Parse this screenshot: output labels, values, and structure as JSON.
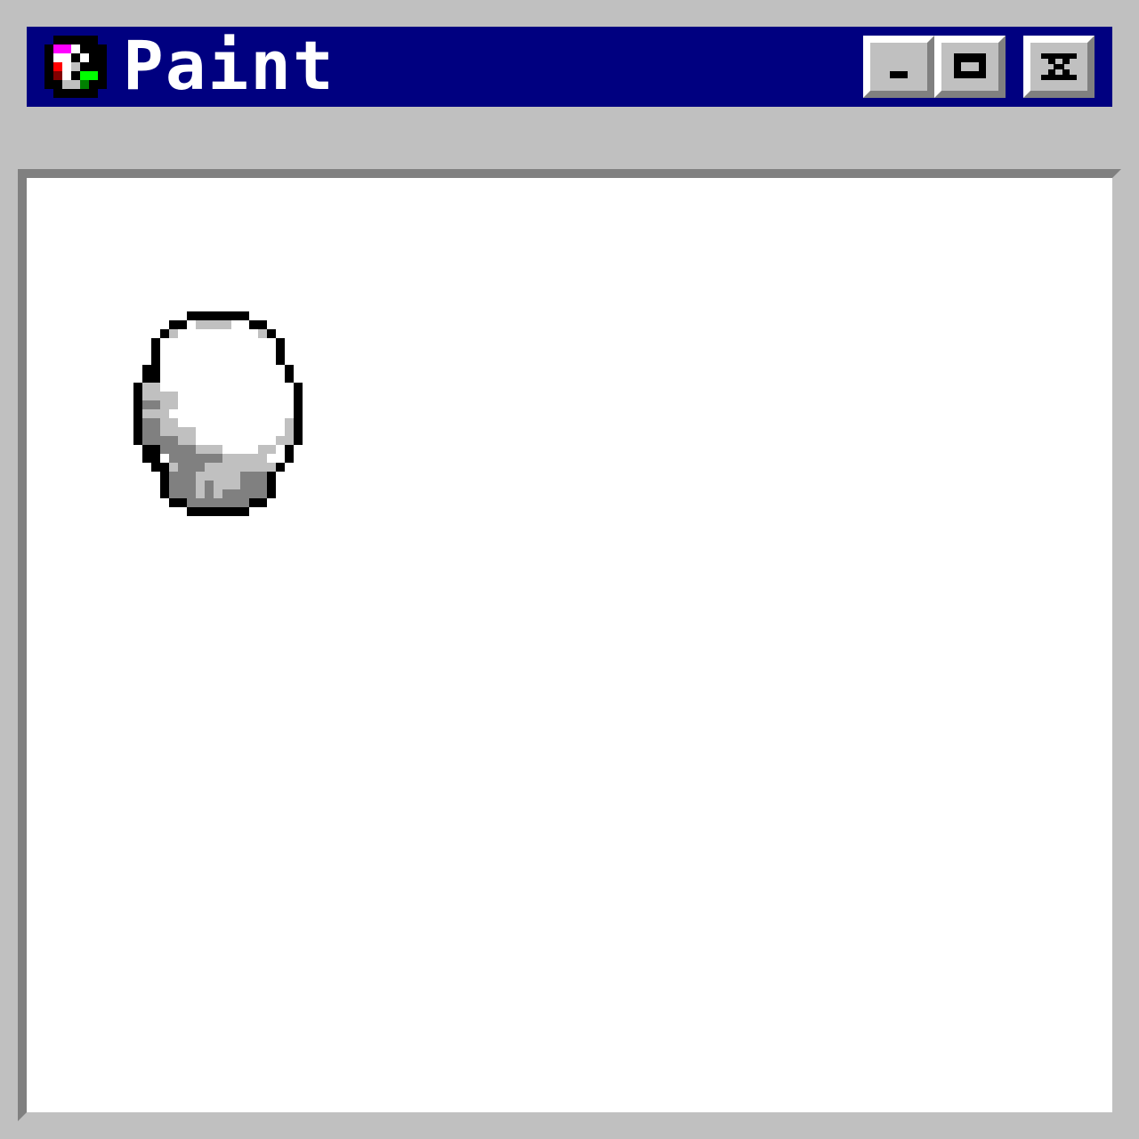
{
  "window": {
    "title": "Paint",
    "title_bar_color": "#000080",
    "controls": {
      "minimize_icon": "minimize-icon",
      "maximize_icon": "maximize-icon",
      "close_icon": "close-icon"
    },
    "app_icon": "paint-app-icon"
  },
  "canvas": {
    "background": "#ffffff",
    "drawing": "shaded-sphere"
  },
  "colors": {
    "face": "#c0c0c0",
    "shadow": "#808080",
    "highlight": "#ffffff",
    "dark": "#000000"
  }
}
